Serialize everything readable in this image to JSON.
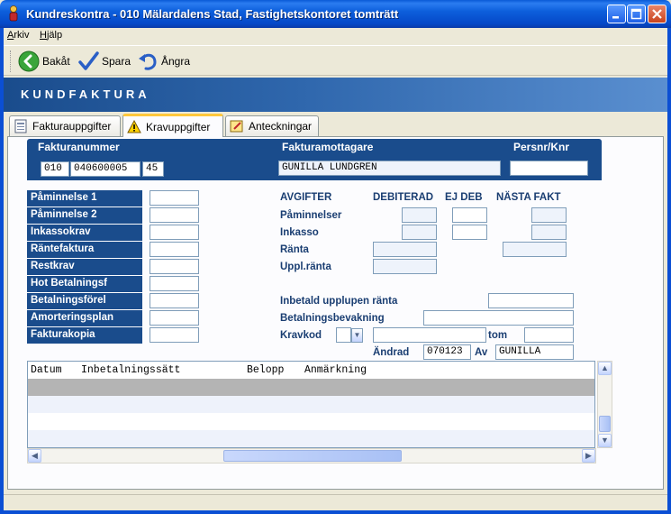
{
  "window": {
    "title": "Kundreskontra  -  010 Mälardalens Stad, Fastighetskontoret tomträtt"
  },
  "menu": [
    "Arkiv",
    "Hjälp"
  ],
  "toolbar": {
    "back_label": "Bakåt",
    "save_label": "Spara",
    "undo_label": "Ångra"
  },
  "band_title": "KUNDFAKTURA",
  "tabs": {
    "fakturauppgifter": "Fakturauppgifter",
    "kravuppgifter": "Kravuppgifter",
    "anteckningar": "Anteckningar",
    "active": "Kravuppgifter"
  },
  "invoice": {
    "headers": {
      "number": "Fakturanummer",
      "recipient": "Fakturamottagare",
      "persnr": "Persnr/Knr"
    },
    "number_part1": "010",
    "number_part2": "040600005",
    "number_part3": "45",
    "recipient": "GUNILLA LUNDGREN",
    "persnr": ""
  },
  "left_labels": [
    "Påminnelse 1",
    "Påminnelse 2",
    "Inkassokrav",
    "Räntefaktura",
    "Restkrav",
    "Hot Betalningsf",
    "Betalningsförel",
    "Amorteringsplan",
    "Fakturakopia"
  ],
  "fees": {
    "headers": {
      "avgifter": "AVGIFTER",
      "debiterad": "DEBITERAD",
      "ej_deb": "EJ DEB",
      "nasta_fakt": "NÄSTA FAKT"
    },
    "rows": {
      "paminnelser": "Påminnelser",
      "inkasso": "Inkasso",
      "ranta": "Ränta",
      "uppl_ranta": "Uppl.ränta"
    }
  },
  "other": {
    "inbetald_label": "Inbetald upplupen ränta",
    "bevakning_label": "Betalningsbevakning",
    "kravkod_label": "Kravkod",
    "tom_label": "tom",
    "andrad_label": "Ändrad",
    "andrad_value": "070123",
    "av_label": "Av",
    "av_value": "GUNILLA"
  },
  "grid": {
    "columns": [
      "Datum",
      "Inbetalningssätt",
      "Belopp",
      "Anmärkning"
    ]
  },
  "colors": {
    "header_navy": "#1a4c8c",
    "row_selected": "#b4b4b4",
    "row_alt": "#eef2fb"
  }
}
